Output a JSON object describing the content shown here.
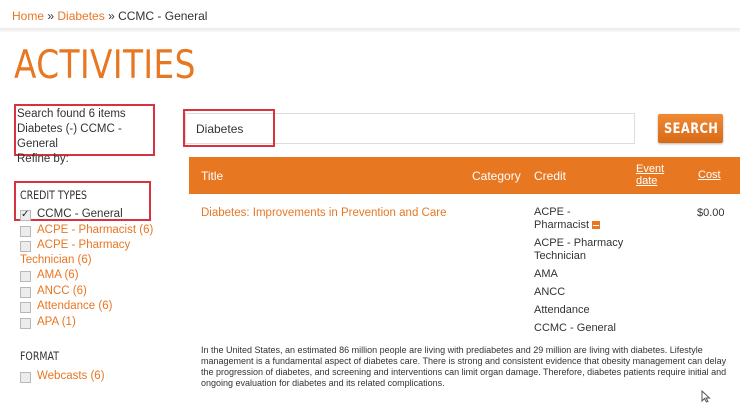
{
  "breadcrumb": {
    "home": "Home",
    "sep1": " » ",
    "diabetes": "Diabetes",
    "sep2": " » ",
    "current": "CCMC - General"
  },
  "page_title": "ACTIVITIES",
  "summary": {
    "found": "Search found 6 items",
    "query_line1": "Diabetes (-) CCMC -",
    "query_line2": "General",
    "refine": "Refine by:"
  },
  "facets": {
    "credit_types": {
      "title": "CREDIT TYPES",
      "items": [
        {
          "label": "CCMC - General",
          "checked": true
        },
        {
          "label": "ACPE - Pharmacist (6)",
          "checked": false
        },
        {
          "label": "ACPE - Pharmacy",
          "label2": "Technician (6)",
          "checked": false
        },
        {
          "label": "AMA (6)",
          "checked": false
        },
        {
          "label": "ANCC (6)",
          "checked": false
        },
        {
          "label": "Attendance (6)",
          "checked": false
        },
        {
          "label": "APA (1)",
          "checked": false
        }
      ]
    },
    "format": {
      "title": "FORMAT",
      "items": [
        {
          "label": "Webcasts (6)",
          "checked": false
        }
      ]
    }
  },
  "search": {
    "value": "Diabetes",
    "button_label": "SEARCH"
  },
  "table": {
    "headers": {
      "title": "Title",
      "category": "Category",
      "credit": "Credit",
      "event_date_1": "Event",
      "event_date_2": "date",
      "cost": "Cost"
    },
    "rows": [
      {
        "title": "Diabetes: Improvements in Prevention and Care",
        "credits": [
          "ACPE -",
          "Pharmacist",
          "ACPE - Pharmacy",
          "Technician",
          "AMA",
          "ANCC",
          "Attendance",
          "CCMC - General"
        ],
        "cost": "$0.00",
        "description": "In the United States, an estimated 86 million people are living with prediabetes and 29 million are living with diabetes. Lifestyle management is a fundamental aspect of diabetes care. There is strong and consistent evidence that obesity management can delay the progression of diabetes, and screening and interventions can limit organ damage. Therefore, diabetes patients require initial and ongoing evaluation for diabetes and its related complications."
      }
    ]
  },
  "colors": {
    "accent": "#e87722",
    "highlight_box": "#d83240"
  }
}
